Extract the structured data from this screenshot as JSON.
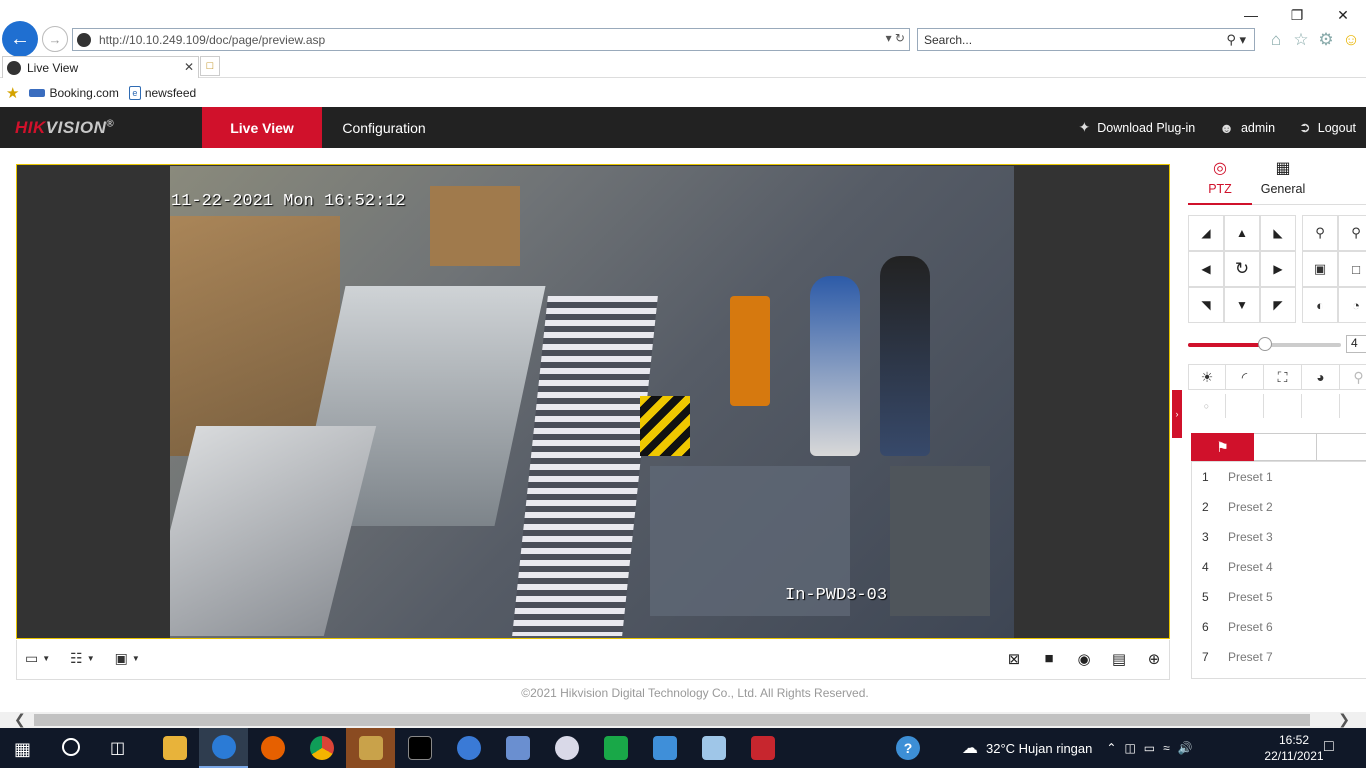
{
  "browser": {
    "url": "http://10.10.249.109/doc/page/preview.asp",
    "search_placeholder": "Search...",
    "tab_title": "Live View",
    "favorites": [
      {
        "label": "Booking.com"
      },
      {
        "label": "newsfeed"
      }
    ]
  },
  "header": {
    "logo_hik": "HIK",
    "logo_vision": "VISION",
    "logo_reg": "®",
    "nav_live": "Live View",
    "nav_config": "Configuration",
    "download": "Download Plug-in",
    "user": "admin",
    "logout": "Logout"
  },
  "video": {
    "timestamp": "11-22-2021 Mon 16:52:12",
    "camera_name": "In-PWD3-03"
  },
  "ptz": {
    "tab_ptz": "PTZ",
    "tab_general": "General",
    "speed_value": "4",
    "speed_fraction": 0.5,
    "presets": [
      {
        "num": "1",
        "label": "Preset 1"
      },
      {
        "num": "2",
        "label": "Preset 2"
      },
      {
        "num": "3",
        "label": "Preset 3"
      },
      {
        "num": "4",
        "label": "Preset 4"
      },
      {
        "num": "5",
        "label": "Preset 5"
      },
      {
        "num": "6",
        "label": "Preset 6"
      },
      {
        "num": "7",
        "label": "Preset 7"
      }
    ]
  },
  "footer": {
    "copyright": "©2021 Hikvision Digital Technology Co., Ltd. All Rights Reserved."
  },
  "taskbar": {
    "weather": "32°C  Hujan ringan",
    "time": "16:52",
    "date": "22/11/2021"
  },
  "colors": {
    "brand_red": "#d0112b",
    "header_bg": "#222222",
    "taskbar_bg": "#101828"
  }
}
